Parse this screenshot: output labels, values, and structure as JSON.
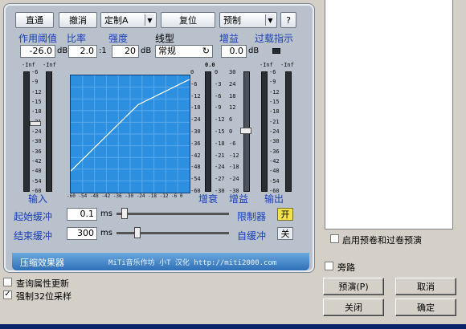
{
  "toolbar": {
    "bypass": "直通",
    "undo": "撤消",
    "preset_select": "定制A",
    "reset": "复位",
    "preset_menu": "预制",
    "help": "?"
  },
  "params": {
    "threshold_label": "作用阈值",
    "ratio_label": "比率",
    "strength_label": "强度",
    "linetype_label": "线型",
    "gain_label": "增益",
    "overload_label": "过载指示",
    "threshold_value": "-26.0",
    "threshold_unit": "dB",
    "ratio_value": "2.0",
    "ratio_unit": ":1",
    "strength_value": "20",
    "strength_unit": "dB",
    "linetype_value": "常规",
    "gain_value": "0.0",
    "gain_unit": "dB"
  },
  "scales": {
    "meter_top_left": "-Inf",
    "meter_top_left2": "-Inf",
    "meter_top_mid": "0.0",
    "meter_top_right": "-Inf",
    "meter_top_right2": "-Inf",
    "left_scale": [
      "-6",
      "-9",
      "-12",
      "-15",
      "-18",
      "-21",
      "-24",
      "-30",
      "-36",
      "-42",
      "-48",
      "-54",
      "-60"
    ],
    "graph_y_scale": [
      "0",
      "-6",
      "-12",
      "-18",
      "-24",
      "-30",
      "-36",
      "-42",
      "-48",
      "-54",
      "-60"
    ],
    "attenuation_scale": [
      "0",
      "-3",
      "-6",
      "-9",
      "-12",
      "-15",
      "-18",
      "-21",
      "-24",
      "-27",
      "-30"
    ],
    "gain_scale": [
      "30",
      "24",
      "18",
      "12",
      "6",
      "0",
      "-6",
      "-12",
      "-18",
      "-24",
      "-30"
    ],
    "right_scale": [
      "-6",
      "-9",
      "-12",
      "-15",
      "-18",
      "-21",
      "-24",
      "-30",
      "-36",
      "-42",
      "-48",
      "-54",
      "-60"
    ],
    "graph_x_scale": "-60 -54 -48 -42 -36 -30 -24 -18 -12 -6 0"
  },
  "meter_labels": {
    "input": "输入",
    "attenuation": "增衰",
    "gain": "增益",
    "output": "输出"
  },
  "timing": {
    "attack_label": "起始缓冲",
    "attack_value": "0.1",
    "attack_unit": "ms",
    "release_label": "结束缓冲",
    "release_value": "300",
    "release_unit": "ms",
    "limiter_label": "限制器",
    "limiter_state": "开",
    "auto_release_label": "自缓冲",
    "auto_release_state": "关"
  },
  "footer": {
    "title": "压缩效果器",
    "credit": "MiTi音乐作坊  小T 汉化  http://miti2000.com"
  },
  "right_panel": {
    "preroll_label": "启用预卷和过卷预演",
    "bypass_label": "旁路",
    "preview_button": "预演(P)",
    "cancel_button": "取消",
    "close_button": "关闭",
    "ok_button": "确定"
  },
  "bottom_left": {
    "query_update_label": "查询属性更新",
    "force32_label": "强制32位采样",
    "force32_checked": true
  },
  "colors": {
    "graph_bg": "#2c8fe0",
    "label_blue": "#1a3fb8",
    "limiter_on": "#f3e24a"
  }
}
